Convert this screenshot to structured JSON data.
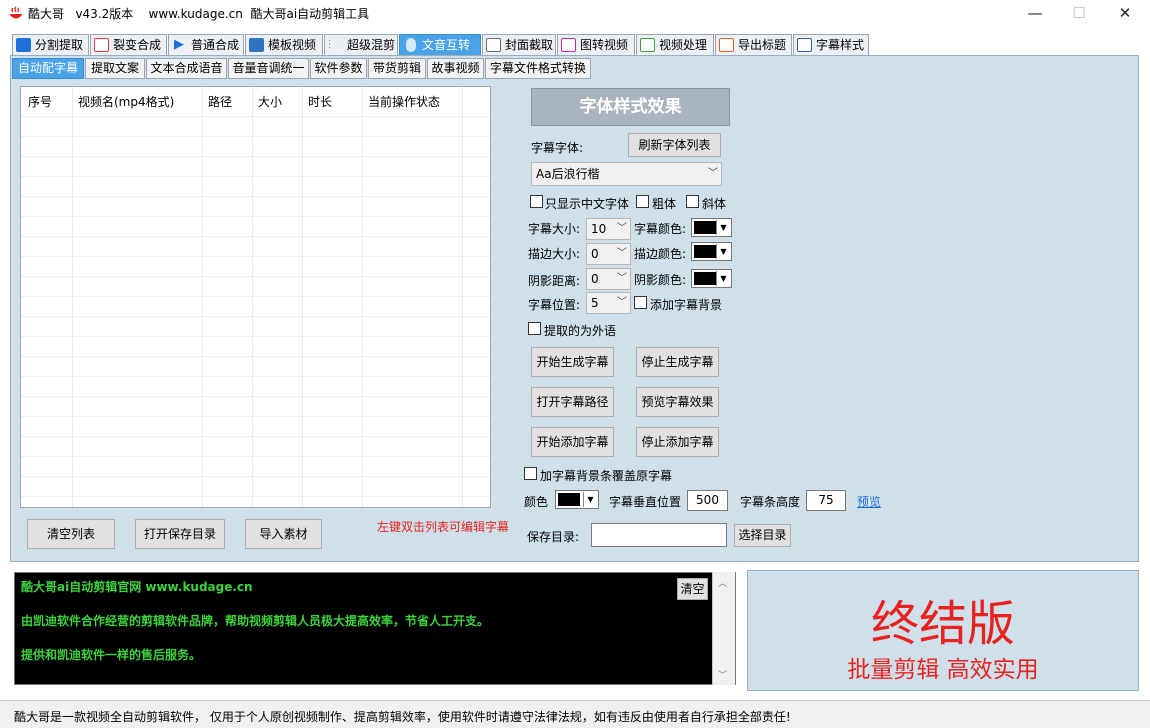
{
  "window": {
    "title": "酷大哥   v43.2版本    www.kudage.cn  酷大哥ai自动剪辑工具",
    "minimize": "—",
    "maximize": "☐",
    "close": "✕"
  },
  "main_tabs": [
    {
      "label": "分割提取",
      "icon": "split-icon",
      "color": "#1f6fd8"
    },
    {
      "label": "裂变合成",
      "icon": "copy-icon",
      "color": "#e04040"
    },
    {
      "label": "普通合成",
      "icon": "play-icon",
      "color": "#1f6fd8"
    },
    {
      "label": "模板视频",
      "icon": "template-icon",
      "color": "#1f6fd8"
    },
    {
      "label": "超级混剪",
      "icon": "wave-icon",
      "color": "#3ab37a"
    },
    {
      "label": "文音互转",
      "icon": "mic-icon",
      "color": "#ffffff"
    },
    {
      "label": "封面截取",
      "icon": "image-icon",
      "color": "#6a6a6a"
    },
    {
      "label": "图转视频",
      "icon": "slideshow-icon",
      "color": "#c02ca8"
    },
    {
      "label": "视频处理",
      "icon": "film-icon",
      "color": "#3aa03a"
    },
    {
      "label": "导出标题",
      "icon": "export-icon",
      "color": "#e0622a"
    },
    {
      "label": "字幕样式",
      "icon": "subtitle-icon",
      "color": "#2a5fa8"
    }
  ],
  "sub_tabs": [
    "自动配字幕",
    "提取文案",
    "文本合成语音",
    "音量音调统一",
    "软件参数",
    "带货剪辑",
    "故事视频",
    "字幕文件格式转换"
  ],
  "list": {
    "columns": [
      "序号",
      "视频名(mp4格式)",
      "路径",
      "大小",
      "时长",
      "当前操作状态"
    ]
  },
  "list_buttons": {
    "clear": "清空列表",
    "open_save_dir": "打开保存目录",
    "import": "导入素材"
  },
  "hint": "左键双击列表可编辑字幕",
  "settings": {
    "header": "字体样式效果",
    "font_label": "字幕字体:",
    "refresh_fonts": "刷新字体列表",
    "font_value": "Aa后浪行楷",
    "only_chinese": "只显示中文字体",
    "bold": "粗体",
    "italic": "斜体",
    "size_label": "字幕大小:",
    "size_value": "10",
    "color_label": "字幕颜色:",
    "stroke_size_label": "描边大小:",
    "stroke_size_value": "0",
    "stroke_color_label": "描边颜色:",
    "shadow_label": "阴影距离:",
    "shadow_value": "0",
    "shadow_color_label": "阴影颜色:",
    "position_label": "字幕位置:",
    "position_value": "5",
    "add_bg": "添加字幕背景",
    "foreign": "提取的为外语",
    "start_gen": "开始生成字幕",
    "stop_gen": "停止生成字幕",
    "open_path": "打开字幕路径",
    "preview_effect": "预览字幕效果",
    "start_add": "开始添加字幕",
    "stop_add": "停止添加字幕",
    "cover_orig": "加字幕背景条覆盖原字幕",
    "color_label2": "颜色",
    "vpos_label": "字幕垂直位置",
    "vpos_value": "500",
    "bar_height_label": "字幕条高度",
    "bar_height_value": "75",
    "preview_link": "预览",
    "save_dir_label": "保存目录:",
    "save_dir_value": "",
    "choose_dir": "选择目录"
  },
  "log": {
    "lines": [
      "酷大哥ai自动剪辑官网  www.kudage.cn",
      "由凯迪软件合作经营的剪辑软件品牌，帮助视频剪辑人员极大提高效率，节省人工开支。",
      "提供和凯迪软件一样的售后服务。"
    ],
    "clear": "清空"
  },
  "promo": {
    "title": "终结版",
    "subtitle": "批量剪辑 高效实用"
  },
  "status": "酷大哥是一款视频全自动剪辑软件，  仅用于个人原创视频制作、提高剪辑效率，使用软件时请遵守法律法规，如有违反由使用者自行承担全部责任!",
  "colors": {
    "accent": "#4aa3e8",
    "panel": "#cfe0ea",
    "promo_red": "#e8231f",
    "log_green": "#3dd23d"
  }
}
